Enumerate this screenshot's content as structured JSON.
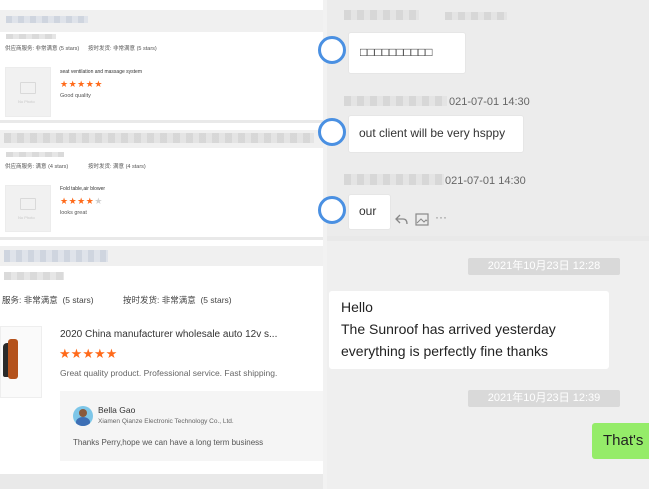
{
  "left": {
    "review1": {
      "service_label": "供应商服务: 非常满意",
      "service_stars": "(5 stars)",
      "ship_label": "按时发货: 非常满意",
      "ship_stars": "(5 stars)",
      "product_title": "seat ventilation and massage system",
      "rating": 5,
      "comment": "Good quality",
      "no_photo": "No Photo"
    },
    "review2": {
      "service_label": "供应商服务: 满意",
      "service_stars": "(4 stars)",
      "ship_label": "按时发货: 满意",
      "ship_stars": "(4 stars)",
      "product_title": "Fold table,air blower",
      "rating": 4,
      "comment": "looks great",
      "no_photo": "No Photo"
    },
    "review3": {
      "service_label": "服务: 非常满意",
      "service_stars": "(5 stars)",
      "ship_label": "按时发货: 非常满意",
      "ship_stars": "(5 stars)",
      "product_title": "2020 China manufacturer wholesale auto 12v s...",
      "rating": 5,
      "comment": "Great quality product. Professional service. Fast shipping.",
      "reply": {
        "name": "Bella Gao",
        "company": "Xiamen Qianze Electronic Technology Co., Ltd.",
        "text": "Thanks Perry,hope we can have a long term business"
      }
    }
  },
  "chat_top": {
    "messages": [
      {
        "text": "□□□□□□□□□□",
        "time": ""
      },
      {
        "text": "out client will be very hsppy",
        "time": "021-07-01 14:30"
      },
      {
        "text": "our",
        "time": "021-07-01 14:30"
      }
    ]
  },
  "chat_bottom": {
    "stamp1": "2021年10月23日 12:28",
    "message_lines": [
      "Hello",
      "The Sunroof has arrived yesterday",
      "everything is perfectly fine thanks"
    ],
    "stamp2": "2021年10月23日 12:39",
    "sent_text": "That's"
  },
  "icons": [
    "reply-icon",
    "image-icon",
    "more-icon",
    "avatar-icon",
    "star-icon"
  ],
  "colors": {
    "star": "#ff6a1a",
    "sent_bubble": "#95ec69",
    "avatar_ring": "#4a90e2",
    "divider": "#e0e0e0"
  }
}
